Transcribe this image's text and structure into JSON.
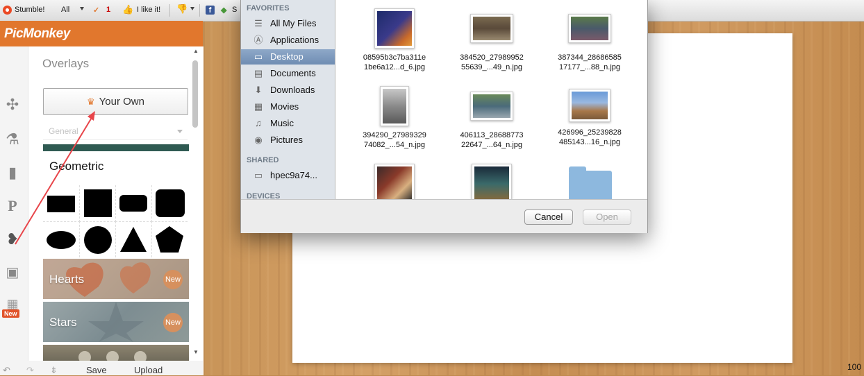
{
  "toolbar": {
    "stumble": "Stumble!",
    "all": "All",
    "notif_count": "1",
    "like": "I like it!",
    "truncated": "S"
  },
  "app": {
    "brand": "PicMonkey"
  },
  "panel": {
    "title": "Overlays",
    "your_own": "Your Own",
    "select_placeholder": "General",
    "geometric": "Geometric",
    "categories": [
      {
        "label": "Hearts",
        "badge": "New",
        "color": "#c98d6a"
      },
      {
        "label": "Stars",
        "badge": "New",
        "color": "#7d8f96"
      },
      {
        "label": "",
        "badge": "",
        "color": "#8d8470"
      }
    ]
  },
  "left_strip": {
    "new_badge": "New"
  },
  "bottom": {
    "save": "Save",
    "upload": "Upload"
  },
  "canvas": {
    "zoom": "100"
  },
  "dialog": {
    "favorites_header": "FAVORITES",
    "favorites": [
      {
        "label": "All My Files",
        "icon": "all-files-icon"
      },
      {
        "label": "Applications",
        "icon": "applications-icon"
      },
      {
        "label": "Desktop",
        "icon": "desktop-icon",
        "selected": true
      },
      {
        "label": "Documents",
        "icon": "documents-icon"
      },
      {
        "label": "Downloads",
        "icon": "downloads-icon"
      },
      {
        "label": "Movies",
        "icon": "movies-icon"
      },
      {
        "label": "Music",
        "icon": "music-icon"
      },
      {
        "label": "Pictures",
        "icon": "pictures-icon"
      }
    ],
    "shared_header": "SHARED",
    "shared": [
      {
        "label": "hpec9a74...",
        "icon": "monitor-icon"
      }
    ],
    "devices_header": "DEVICES",
    "files": [
      {
        "line1": "08595b3c7ba311e",
        "line2": "1be6a12...d_6.jpg"
      },
      {
        "line1": "384520_27989952",
        "line2": "55639_...49_n.jpg"
      },
      {
        "line1": "387344_28686585",
        "line2": "17177_...88_n.jpg"
      },
      {
        "line1": "394290_27989329",
        "line2": "74082_...54_n.jpg"
      },
      {
        "line1": "406113_28688773",
        "line2": "22647_...64_n.jpg"
      },
      {
        "line1": "426996_25239828",
        "line2": "485143...16_n.jpg"
      }
    ],
    "cancel": "Cancel",
    "open": "Open"
  },
  "colors": {
    "brand_orange": "#e1772d",
    "selection_blue": "#6f8db3",
    "annotation_red": "#e8454a"
  }
}
